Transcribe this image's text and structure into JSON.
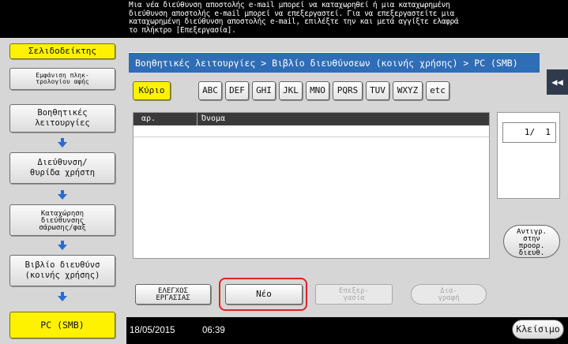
{
  "message": "Μια νέα διεύθυνση αποστολής e-mail μπορεί να καταχωρηθεί ή μια καταχωρημένη\nδιεύθυνση αποστολής e-mail μπορεί να επεξεργαστεί. Για να επεξεργαστείτε μια\nκαταχωρημένη διεύθυνση αποστολής e-mail, επιλέξτε την και μετά αγγίξτε ελαφρά\nτο πλήκτρο [Επεξεργασία].",
  "sidebar": {
    "bookmark_label": "Σελιδοδείκτης",
    "view_keypad_line1": "Εμφάνιση πληκ-",
    "view_keypad_line2": "τρολογίου αφής",
    "steps": [
      {
        "line1": "Βοηθητικές",
        "line2": "λειτουργίες"
      },
      {
        "line1": "Διεύθυνση/",
        "line2": "θυρίδα χρήστη"
      },
      {
        "line1": "Καταχώρηση",
        "line2": "διεύθυνσης",
        "line3": "σάρωσης/φαξ"
      },
      {
        "line1": "Βιβλίο διευθύνσ",
        "line2": "(κοινής χρήσης)"
      },
      {
        "line1": "PC (SMB)"
      }
    ]
  },
  "breadcrumb": "Βοηθητικές λειτουργίες > Βιβλίο διευθύνσεων (κοινής χρήσης) > PC (SMB)",
  "collapse_icon": "◀◀",
  "tabs": [
    "Κύριο",
    "ABC",
    "DEF",
    "GHI",
    "JKL",
    "MNO",
    "PQRS",
    "TUV",
    "WXYZ",
    "etc"
  ],
  "list": {
    "col_number": "αρ.",
    "col_name": "Όνομα"
  },
  "pager": {
    "page": "1/",
    "total": "1"
  },
  "jump_button": {
    "line1": "Αντιγρ.",
    "line2": "στην",
    "line3": "προορ.",
    "line4": "διευθ."
  },
  "buttons": {
    "check_job_line1": "ΕΛΕΓΧΟΣ",
    "check_job_line2": "ΕΡΓΑΣΙΑΣ",
    "new": "Νέο",
    "edit_line1": "Επεξερ-",
    "edit_line2": "γασία",
    "delete_line1": "Δια-",
    "delete_line2": "γραφή",
    "close": "Κλείσιμο"
  },
  "status": {
    "date": "18/05/2015",
    "time": "06:39"
  },
  "colors": {
    "accent_selected": "#fff200",
    "path_bar": "#2f6db7",
    "highlight": "#e0202a"
  }
}
